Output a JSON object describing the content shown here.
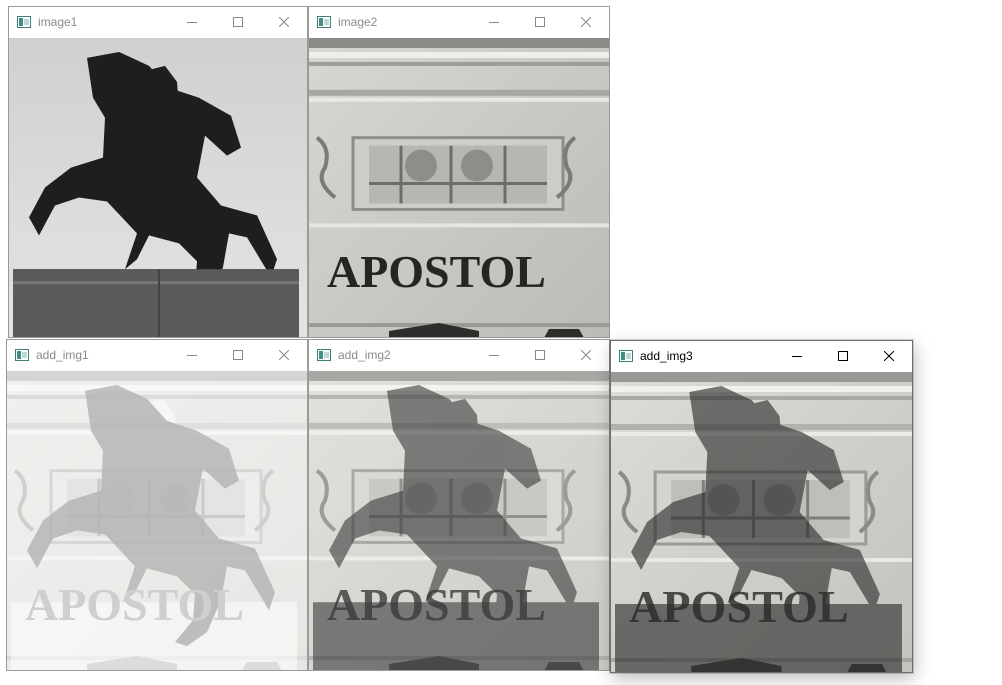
{
  "windows": [
    {
      "id": "image1",
      "title": "image1",
      "kind": "statue"
    },
    {
      "id": "image2",
      "title": "image2",
      "kind": "building"
    },
    {
      "id": "add_img1",
      "title": "add_img1",
      "kind": "blend-light"
    },
    {
      "id": "add_img2",
      "title": "add_img2",
      "kind": "blend-mid"
    },
    {
      "id": "add_img3",
      "title": "add_img3",
      "kind": "blend-dark"
    }
  ],
  "building_text": "APOSTOL",
  "icons": {
    "app": "opencv-window-icon",
    "minimize": "minimize-icon",
    "maximize": "maximize-icon",
    "close": "close-icon"
  },
  "colors": {
    "icon_accent": "#3f8f86",
    "inactive_title": "#8a8a8a",
    "active_title": "#000000"
  }
}
